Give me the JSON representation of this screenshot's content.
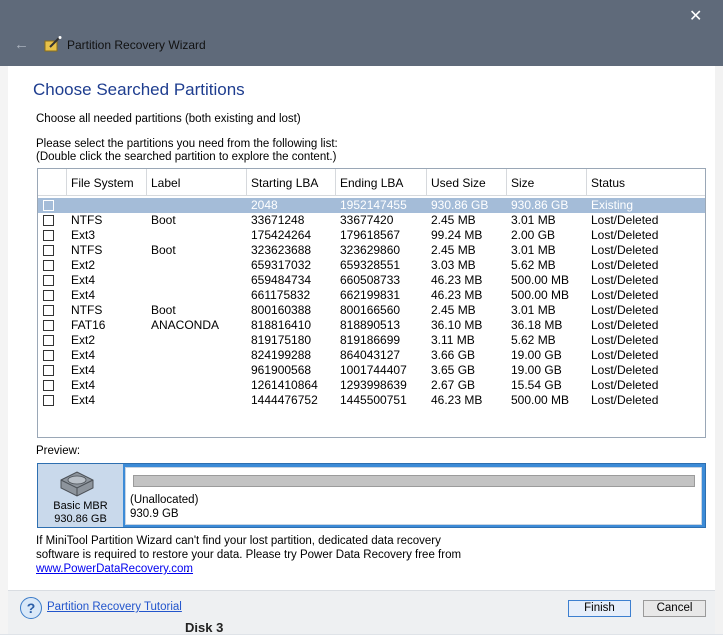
{
  "window": {
    "title": "Partition Recovery Wizard",
    "close_symbol": "✕"
  },
  "header": {
    "title": "Choose Searched Partitions",
    "subtitle": "Choose all needed partitions (both existing and lost)"
  },
  "instructions": {
    "line1": "Please select the partitions you need from the following list:",
    "line2": "(Double click the searched partition to explore the content.)"
  },
  "table": {
    "columns": [
      "File System",
      "Label",
      "Starting LBA",
      "Ending LBA",
      "Used Size",
      "Size",
      "Status"
    ],
    "rows": [
      {
        "fs": "",
        "label": "",
        "start": "2048",
        "end": "1952147455",
        "used": "930.86 GB",
        "size": "930.86 GB",
        "status": "Existing",
        "selected": true
      },
      {
        "fs": "NTFS",
        "label": "Boot",
        "start": "33671248",
        "end": "33677420",
        "used": "2.45 MB",
        "size": "3.01 MB",
        "status": "Lost/Deleted"
      },
      {
        "fs": "Ext3",
        "label": "",
        "start": "175424264",
        "end": "179618567",
        "used": "99.24 MB",
        "size": "2.00 GB",
        "status": "Lost/Deleted"
      },
      {
        "fs": "NTFS",
        "label": "Boot",
        "start": "323623688",
        "end": "323629860",
        "used": "2.45 MB",
        "size": "3.01 MB",
        "status": "Lost/Deleted"
      },
      {
        "fs": "Ext2",
        "label": "",
        "start": "659317032",
        "end": "659328551",
        "used": "3.03 MB",
        "size": "5.62 MB",
        "status": "Lost/Deleted"
      },
      {
        "fs": "Ext4",
        "label": "",
        "start": "659484734",
        "end": "660508733",
        "used": "46.23 MB",
        "size": "500.00 MB",
        "status": "Lost/Deleted"
      },
      {
        "fs": "Ext4",
        "label": "",
        "start": "661175832",
        "end": "662199831",
        "used": "46.23 MB",
        "size": "500.00 MB",
        "status": "Lost/Deleted"
      },
      {
        "fs": "NTFS",
        "label": "Boot",
        "start": "800160388",
        "end": "800166560",
        "used": "2.45 MB",
        "size": "3.01 MB",
        "status": "Lost/Deleted"
      },
      {
        "fs": "FAT16",
        "label": "ANACONDA",
        "start": "818816410",
        "end": "818890513",
        "used": "36.10 MB",
        "size": "36.18 MB",
        "status": "Lost/Deleted"
      },
      {
        "fs": "Ext2",
        "label": "",
        "start": "819175180",
        "end": "819186699",
        "used": "3.11 MB",
        "size": "5.62 MB",
        "status": "Lost/Deleted"
      },
      {
        "fs": "Ext4",
        "label": "",
        "start": "824199288",
        "end": "864043127",
        "used": "3.66 GB",
        "size": "19.00 GB",
        "status": "Lost/Deleted"
      },
      {
        "fs": "Ext4",
        "label": "",
        "start": "961900568",
        "end": "1001744407",
        "used": "3.65 GB",
        "size": "19.00 GB",
        "status": "Lost/Deleted"
      },
      {
        "fs": "Ext4",
        "label": "",
        "start": "1261410864",
        "end": "1293998639",
        "used": "2.67 GB",
        "size": "15.54 GB",
        "status": "Lost/Deleted"
      },
      {
        "fs": "Ext4",
        "label": "",
        "start": "1444476752",
        "end": "1445500751",
        "used": "46.23 MB",
        "size": "500.00 MB",
        "status": "Lost/Deleted"
      }
    ]
  },
  "preview": {
    "label": "Preview:",
    "disk_name": "Basic MBR",
    "disk_size": "930.86 GB",
    "partition_name": "(Unallocated)",
    "partition_size": "930.9 GB"
  },
  "info": {
    "line1": "If MiniTool Partition Wizard can't find your lost partition, dedicated data recovery",
    "line2": "software is required to restore your data. Please try Power Data Recovery free from",
    "link": "www.PowerDataRecovery.com",
    "link_suffix": "."
  },
  "footer": {
    "help_symbol": "?",
    "tutorial_link": "Partition Recovery Tutorial",
    "finish_label": "Finish",
    "cancel_label": "Cancel"
  },
  "background": {
    "disk_label": "Disk 3"
  }
}
